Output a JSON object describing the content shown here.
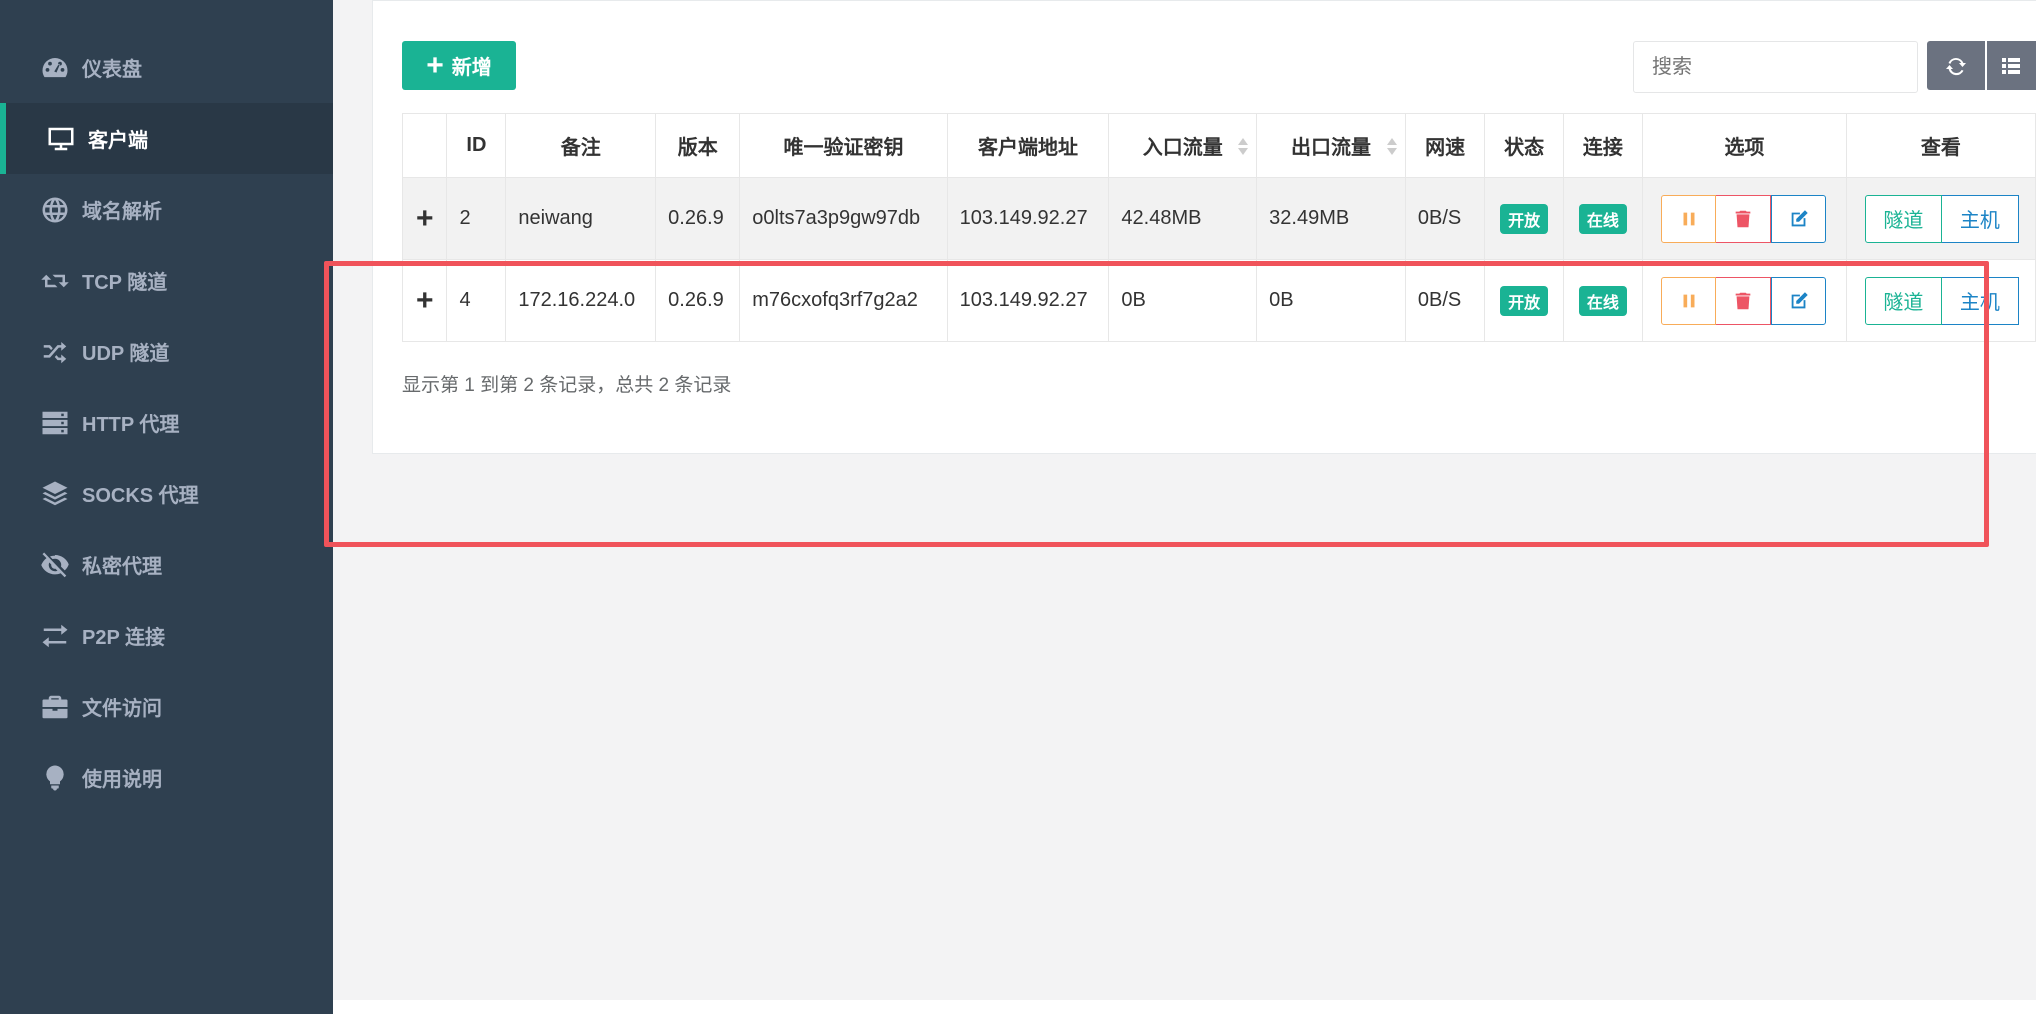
{
  "sidebar": {
    "items": [
      {
        "label": "仪表盘",
        "icon": "dashboard-icon",
        "active": false
      },
      {
        "label": "客户端",
        "icon": "monitor-icon",
        "active": true
      },
      {
        "label": "域名解析",
        "icon": "globe-icon",
        "active": false
      },
      {
        "label": "TCP 隧道",
        "icon": "retweet-icon",
        "active": false
      },
      {
        "label": "UDP 隧道",
        "icon": "random-icon",
        "active": false
      },
      {
        "label": "HTTP 代理",
        "icon": "server-icon",
        "active": false
      },
      {
        "label": "SOCKS 代理",
        "icon": "layers-icon",
        "active": false
      },
      {
        "label": "私密代理",
        "icon": "eye-slash-icon",
        "active": false
      },
      {
        "label": "P2P 连接",
        "icon": "exchange-icon",
        "active": false
      },
      {
        "label": "文件访问",
        "icon": "briefcase-icon",
        "active": false
      },
      {
        "label": "使用说明",
        "icon": "lightbulb-icon",
        "active": false
      }
    ]
  },
  "toolbar": {
    "add_label": "新增",
    "search_placeholder": "搜索"
  },
  "table": {
    "columns": [
      "",
      "ID",
      "备注",
      "版本",
      "唯一验证密钥",
      "客户端地址",
      "入口流量",
      "出口流量",
      "网速",
      "状态",
      "连接",
      "选项",
      "查看"
    ],
    "rows": [
      {
        "id": "2",
        "remark": "neiwang",
        "version": "0.26.9",
        "key": "o0lts7a3p9gw97db",
        "address": "103.149.92.27",
        "in_flow": "42.48MB",
        "out_flow": "32.49MB",
        "speed": "0B/S",
        "status": "开放",
        "connect": "在线",
        "tunnel": "隧道",
        "host": "主机"
      },
      {
        "id": "4",
        "remark": "172.16.224.0",
        "version": "0.26.9",
        "key": "m76cxofq3rf7g2a2",
        "address": "103.149.92.27",
        "in_flow": "0B",
        "out_flow": "0B",
        "speed": "0B/S",
        "status": "开放",
        "connect": "在线",
        "tunnel": "隧道",
        "host": "主机"
      }
    ]
  },
  "footer": {
    "records": "显示第 1 到第 2 条记录，总共 2 条记录"
  },
  "colors": {
    "sidebar_bg": "#2f4050",
    "accent": "#1ab394",
    "highlight_box": "#f0535a"
  }
}
